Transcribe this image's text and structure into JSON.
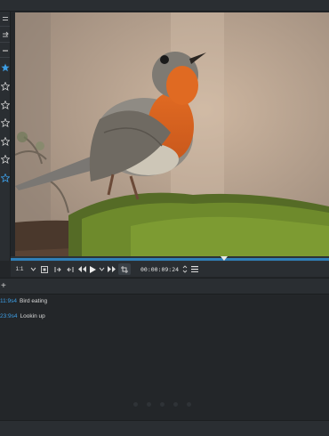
{
  "player": {
    "zoom_label": "1:1",
    "timecode": "00:00:09:24"
  },
  "markers": [
    {
      "time": "11:9s4",
      "label": "Bird eating"
    },
    {
      "time": "23:9s4",
      "label": "Lookin up"
    }
  ],
  "icons": {
    "rating": "star-icon",
    "play": "play-icon",
    "rewind": "rewind-icon",
    "fast_forward": "fast-forward-icon",
    "menu": "hamburger-icon",
    "add": "plus-icon"
  },
  "colors": {
    "accent": "#3d9ee5",
    "background": "#232629",
    "panel": "#2a2e32"
  }
}
